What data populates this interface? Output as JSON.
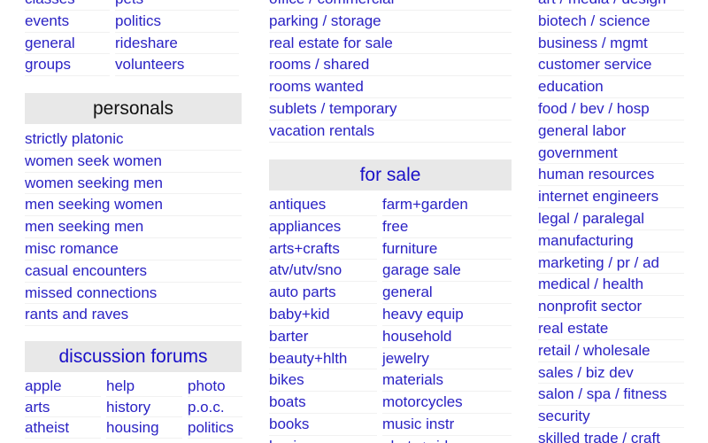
{
  "community": {
    "col1": [
      "classes",
      "events",
      "general",
      "groups"
    ],
    "col2": [
      "pets",
      "politics",
      "rideshare",
      "volunteers"
    ]
  },
  "personals": {
    "title": "personals",
    "items": [
      "strictly platonic",
      "women seek women",
      "women seeking men",
      "men seeking women",
      "men seeking men",
      "misc romance",
      "casual encounters",
      "missed connections",
      "rants and raves"
    ]
  },
  "forums": {
    "title": "discussion forums",
    "col1": [
      "apple",
      "arts",
      "atheist"
    ],
    "col2": [
      "help",
      "history",
      "housing"
    ],
    "col3": [
      "photo",
      "p.o.c.",
      "politics"
    ]
  },
  "housing": {
    "items": [
      "office / commercial",
      "parking / storage",
      "real estate for sale",
      "rooms / shared",
      "rooms wanted",
      "sublets / temporary",
      "vacation rentals"
    ]
  },
  "for_sale": {
    "title": "for sale",
    "col1": [
      "antiques",
      "appliances",
      "arts+crafts",
      "atv/utv/sno",
      "auto parts",
      "baby+kid",
      "barter",
      "beauty+hlth",
      "bikes",
      "boats",
      "books",
      "business"
    ],
    "col2": [
      "farm+garden",
      "free",
      "furniture",
      "garage sale",
      "general",
      "heavy equip",
      "household",
      "jewelry",
      "materials",
      "motorcycles",
      "music instr",
      "photo+video"
    ]
  },
  "jobs": {
    "items": [
      "art / media / design",
      "biotech / science",
      "business / mgmt",
      "customer service",
      "education",
      "food / bev / hosp",
      "general labor",
      "government",
      "human resources",
      "internet engineers",
      "legal / paralegal",
      "manufacturing",
      "marketing / pr / ad",
      "medical / health",
      "nonprofit sector",
      "real estate",
      "retail / wholesale",
      "sales / biz dev",
      "salon / spa / fitness",
      "security",
      "skilled trade / craft"
    ]
  },
  "colors": {
    "link": "#2a22c4",
    "header_bg": "#e8e8e8",
    "header_blue": "#1a10c8"
  }
}
